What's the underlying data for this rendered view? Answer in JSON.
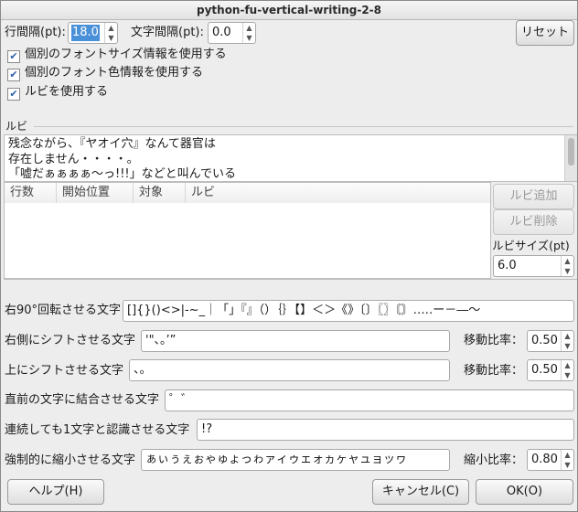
{
  "window": {
    "title": "python-fu-vertical-writing-2-8"
  },
  "spacing": {
    "line_label": "行間隔(pt):",
    "line_value": "18.0",
    "char_label": "文字間隔(pt):",
    "char_value": "0.0",
    "reset_label": "リセット"
  },
  "options": [
    {
      "label": "個別のフォントサイズ情報を使用する",
      "checked": true
    },
    {
      "label": "個別のフォント色情報を使用する",
      "checked": true
    },
    {
      "label": "ルビを使用する",
      "checked": true
    }
  ],
  "ruby": {
    "section_label": "ルビ",
    "text_lines": [
      "残念ながら、『ヤオイ穴』なんて器官は",
      "存在しません・・・・。",
      "「嘘だぁぁぁぁ〜っ!!!」などと叫んでいる"
    ],
    "columns": [
      "行数",
      "開始位置",
      "対象",
      "ルビ"
    ],
    "add_label": "ルビ追加",
    "delete_label": "ルビ削除",
    "size_label": "ルビサイズ(pt)",
    "size_value": "6.0"
  },
  "fields": {
    "rotate_label": "右90°回転させる文字",
    "rotate_value": "[]{}()<>|-~_｜「」『』（）｛｝【】＜＞《》〔〕〖〗〘〙…‥ー－―〜",
    "right_shift_label": "右側にシフトさせる文字",
    "right_shift_value": "'\"、。’”",
    "right_ratio_label": "移動比率：",
    "right_ratio_value": "0.50",
    "up_shift_label": "上にシフトさせる文字",
    "up_shift_value": "、。",
    "up_ratio_label": "移動比率：",
    "up_ratio_value": "0.50",
    "combine_label": "直前の文字に結合させる文字",
    "combine_value": "゜゛",
    "single_label": "連続しても1文字と認識させる文字",
    "single_value": "!?",
    "shrink_label": "強制的に縮小させる文字",
    "shrink_value": "ぁぃぅぇぉゃゅょっゎァィゥェォヵヶャュョッヮ",
    "shrink_ratio_label": "縮小比率：",
    "shrink_ratio_value": "0.80"
  },
  "footer": {
    "help_label": "ヘルプ(H)",
    "cancel_label": "キャンセル(C)",
    "ok_label": "OK(O)"
  }
}
